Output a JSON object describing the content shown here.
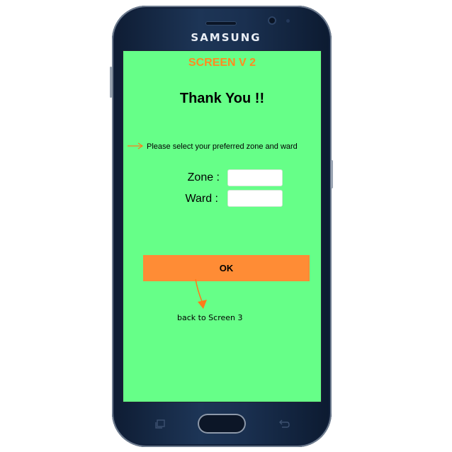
{
  "device": {
    "brand": "SAMSUNG"
  },
  "screen": {
    "label": "SCREEN V 2",
    "title": "Thank You !!",
    "instruction": "Please select your preferred zone and ward",
    "zone": {
      "label": "Zone :",
      "value": ""
    },
    "ward": {
      "label": "Ward :",
      "value": ""
    },
    "ok_label": "OK",
    "back_note": "back to Screen 3"
  },
  "colors": {
    "screen_background": "#66ff88",
    "accent_orange": "#ff8c35",
    "label_orange": "#ff8b1f"
  },
  "icons": {
    "instruction_arrow": "arrow-right-icon",
    "back_arrow": "arrow-down-icon",
    "recents_key": "recents-icon",
    "back_key": "back-icon"
  }
}
